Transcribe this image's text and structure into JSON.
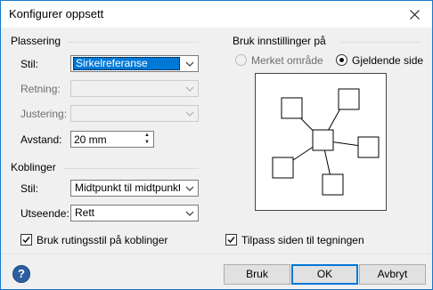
{
  "window": {
    "title": "Konfigurer oppsett"
  },
  "placement": {
    "group_label": "Plassering",
    "style": {
      "label": "Stil:",
      "value": "Sirkelreferanse"
    },
    "direction": {
      "label": "Retning:",
      "value": ""
    },
    "alignment": {
      "label": "Justering:",
      "value": ""
    },
    "spacing": {
      "label": "Avstand:",
      "value": "20 mm"
    }
  },
  "connectors": {
    "group_label": "Koblinger",
    "style": {
      "label": "Stil:",
      "value": "Midtpunkt til midtpunkt"
    },
    "appearance": {
      "label": "Utseende:",
      "value": "Rett"
    },
    "routing_checkbox": {
      "label": "Bruk rutingsstil på koblinger",
      "checked": true
    }
  },
  "apply_settings": {
    "group_label": "Bruk innstillinger på",
    "options": [
      {
        "label": "Merket område",
        "selected": false,
        "enabled": false
      },
      {
        "label": "Gjeldende side",
        "selected": true,
        "enabled": true
      }
    ]
  },
  "fit_page_checkbox": {
    "label": "Tilpass siden til tegningen",
    "checked": true
  },
  "buttons": {
    "apply": "Bruk",
    "ok": "OK",
    "cancel": "Avbryt"
  },
  "help": {
    "glyph": "?"
  },
  "icons": {
    "close": "close-icon",
    "dropdown": "chevron-down-icon",
    "help": "help-icon"
  }
}
